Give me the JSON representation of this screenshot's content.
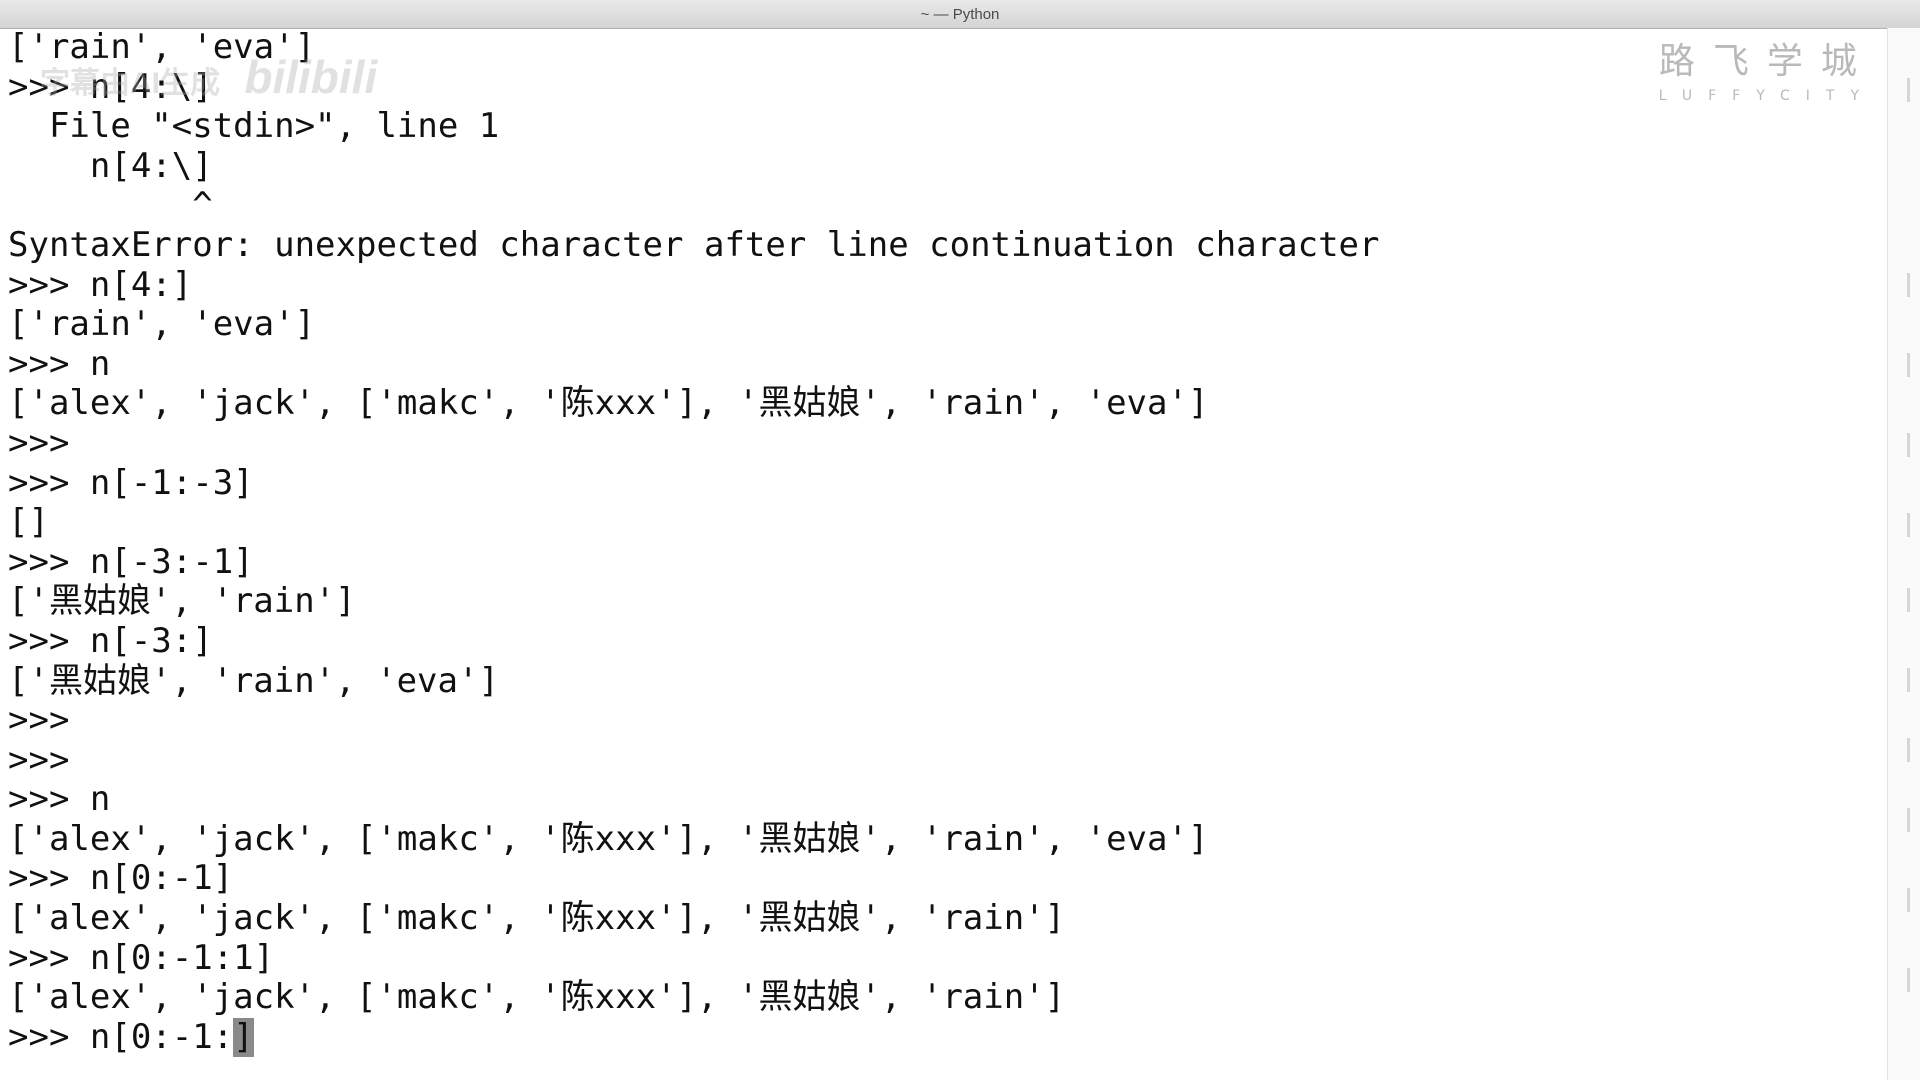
{
  "window": {
    "title": "~ — Python"
  },
  "watermark": {
    "text": "字幕由AI生成 ",
    "bilibili": "bilibili"
  },
  "logo": {
    "cn": "路飞学城",
    "en": "LUFFYCITY"
  },
  "terminal": {
    "lines": [
      "['rain', 'eva']",
      ">>> n[4:\\]",
      "  File \"<stdin>\", line 1",
      "    n[4:\\]",
      "         ^",
      "SyntaxError: unexpected character after line continuation character",
      ">>> n[4:]",
      "['rain', 'eva']",
      ">>> n",
      "['alex', 'jack', ['makc', '陈xxx'], '黑姑娘', 'rain', 'eva']",
      ">>>",
      ">>> n[-1:-3]",
      "[]",
      ">>> n[-3:-1]",
      "['黑姑娘', 'rain']",
      ">>> n[-3:]",
      "['黑姑娘', 'rain', 'eva']",
      ">>>",
      ">>>",
      ">>> n",
      "['alex', 'jack', ['makc', '陈xxx'], '黑姑娘', 'rain', 'eva']",
      ">>> n[0:-1]",
      "['alex', 'jack', ['makc', '陈xxx'], '黑姑娘', 'rain']",
      ">>> n[0:-1:1]",
      "['alex', 'jack', ['makc', '陈xxx'], '黑姑娘', 'rain']"
    ],
    "input_prefix": ">>> n[0:-1:",
    "cursor_char": "]"
  }
}
